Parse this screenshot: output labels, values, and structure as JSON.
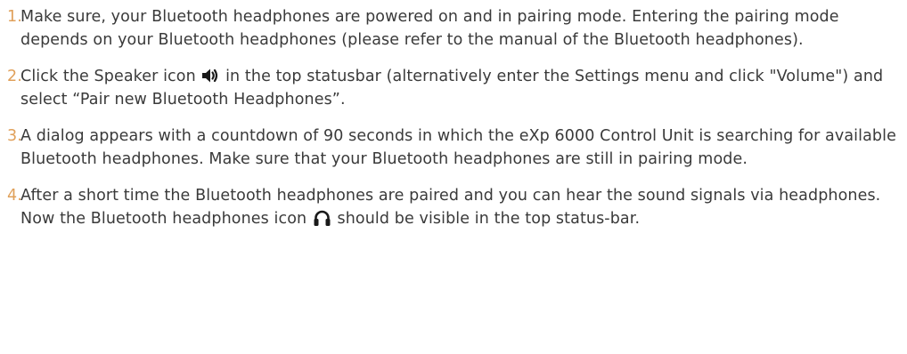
{
  "steps": [
    {
      "number": "1.",
      "text": "Make sure, your Bluetooth headphones are powered on and in pairing mode. Entering the pairing mode depends on your Bluetooth headphones (please refer to the manual of the Bluetooth headphones)."
    },
    {
      "number": "2.",
      "text_before_icon": "Click the Speaker icon ",
      "icon": "speaker-icon",
      "text_after_icon": " in the top statusbar (alternatively enter the Settings menu and click \"Volume\") and select “Pair new Bluetooth Headphones”."
    },
    {
      "number": "3.",
      "text": "A dialog appears with a countdown of 90 seconds in which the eXp 6000 Control Unit is searching for available Bluetooth headphones. Make sure that your Bluetooth headphones are still in pairing mode."
    },
    {
      "number": "4.",
      "text_before_icon": "After a short time the Bluetooth headphones are paired and you can hear the sound signals via headphones. Now the Bluetooth headphones icon ",
      "icon": "headphones-icon",
      "text_after_icon": " should be visible in the top status-bar."
    }
  ],
  "colors": {
    "text": "#3a3a3a",
    "number": "#e0a05a"
  }
}
